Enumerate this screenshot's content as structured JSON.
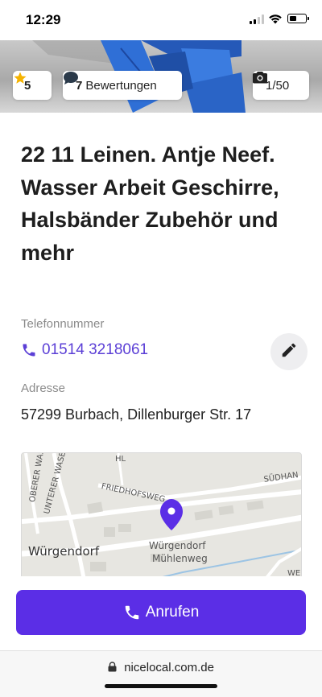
{
  "status_bar": {
    "time": "12:29"
  },
  "hero": {
    "rating": "5",
    "reviews_count": "7",
    "reviews_label": "Bewertungen",
    "photos": "1/50",
    "strap_color": "#2f6fd6"
  },
  "listing": {
    "title": "22 11 Leinen. Antje Neef. Wasser Arbeit Geschirre, Halsbänder Zubehör und mehr",
    "phone_label": "Telefonnummer",
    "phone": "01514 3218061",
    "address_label": "Adresse",
    "address": "57299 Burbach, Dillenburger Str. 17"
  },
  "map": {
    "labels": {
      "oberer": "OBERER WASEN",
      "unterer": "UNTERER WASEN",
      "friedhof": "FRIEDHOFSWEG",
      "suedhang": "SÜDHAN",
      "town": "Würgendorf",
      "station_line1": "Würgendorf",
      "station_line2": "Mühlenweg",
      "we": "WE",
      "hl": "HL"
    },
    "pin_color": "#5b2ee6"
  },
  "actions": {
    "call_label": "Anrufen"
  },
  "browser": {
    "url": "nicelocal.com.de"
  },
  "colors": {
    "accent": "#5b2ee6",
    "link": "#5b3fd6",
    "star": "#f5b301"
  }
}
